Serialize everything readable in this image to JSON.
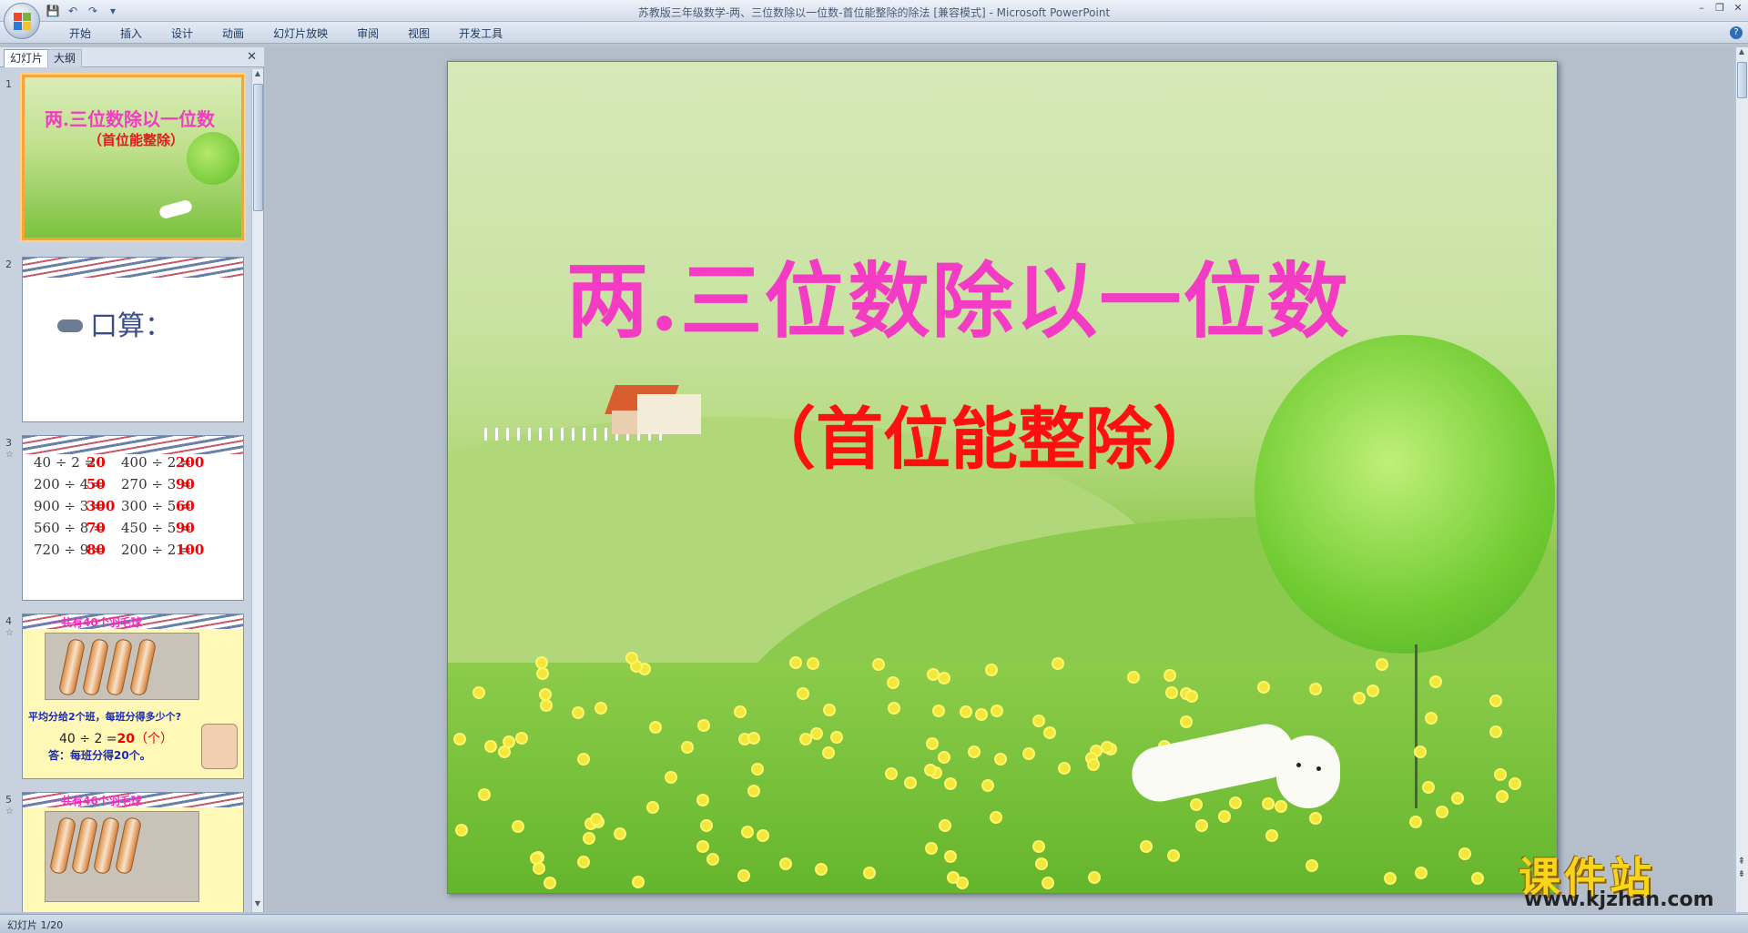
{
  "window": {
    "title": "苏教版三年级数学-两、三位数除以一位数-首位能整除的除法 [兼容模式] - Microsoft PowerPoint"
  },
  "ribbon": {
    "tabs": [
      "开始",
      "插入",
      "设计",
      "动画",
      "幻灯片放映",
      "审阅",
      "视图",
      "开发工具"
    ]
  },
  "pane": {
    "tab_slides": "幻灯片",
    "tab_outline": "大纲",
    "close": "✕"
  },
  "thumbs": {
    "t1": {
      "num": "1",
      "title": "两.三位数除以一位数",
      "sub": "（首位能整除）"
    },
    "t2": {
      "num": "2",
      "text": "口算："
    },
    "t3": {
      "num": "3",
      "left": [
        {
          "eq": "40 ÷ 2 =",
          "ans": "20"
        },
        {
          "eq": "200 ÷ 4 =",
          "ans": "50"
        },
        {
          "eq": "900 ÷ 3 =",
          "ans": "300"
        },
        {
          "eq": "560 ÷ 8 =",
          "ans": "70"
        },
        {
          "eq": "720 ÷ 9 =",
          "ans": "80"
        }
      ],
      "right": [
        {
          "eq": "400 ÷ 2 =",
          "ans": "200"
        },
        {
          "eq": "270 ÷ 3 =",
          "ans": "90"
        },
        {
          "eq": "300 ÷ 5 =",
          "ans": "60"
        },
        {
          "eq": "450 ÷ 5 =",
          "ans": "90"
        },
        {
          "eq": "200 ÷ 2 =",
          "ans": "100"
        }
      ]
    },
    "t4": {
      "num": "4",
      "head": "一共有40个羽毛球",
      "question": "平均分给2个班，每班分得多少个?",
      "eq": "40 ÷ 2 =",
      "ans": "20",
      "unit": "（个）",
      "answer": "答：每班分得20个。"
    },
    "t5": {
      "num": "5",
      "head": "一共有46个羽毛球"
    }
  },
  "slide": {
    "title": "两.三位数除以一位数",
    "subtitle": "（首位能整除）"
  },
  "watermark": {
    "brand": "课件站",
    "url": "www.kjzhan.com"
  },
  "status": {
    "slide_info": "幻灯片 1/20"
  }
}
